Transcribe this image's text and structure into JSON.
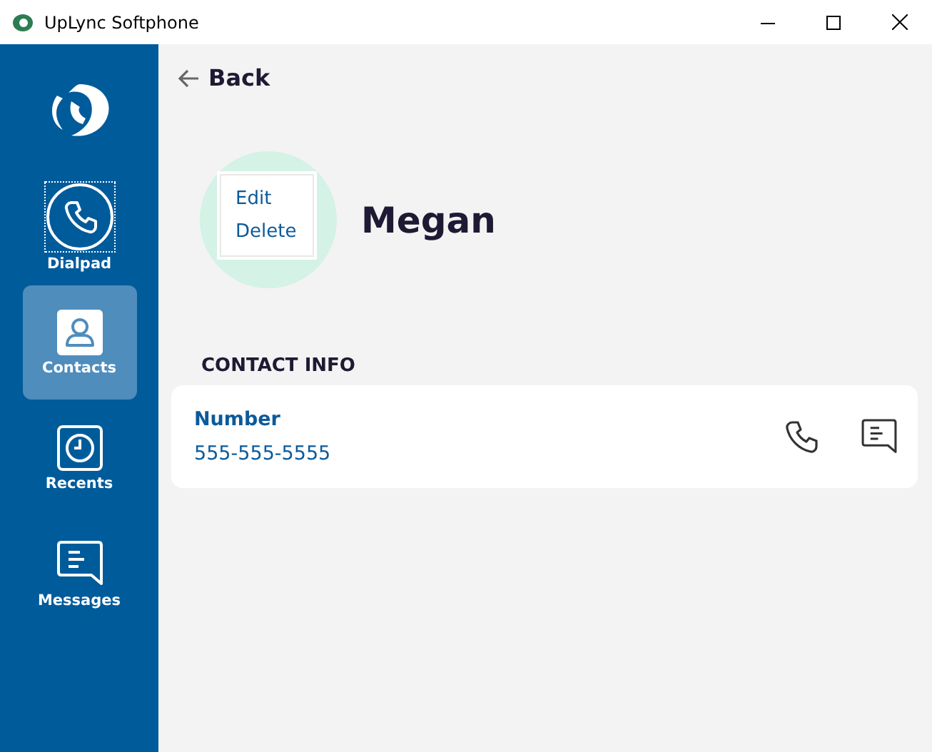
{
  "window": {
    "title": "UpLync Softphone"
  },
  "nav": [
    {
      "kind": "dialpad",
      "label": "Dialpad",
      "selected": false,
      "focused": true
    },
    {
      "kind": "contacts",
      "label": "Contacts",
      "selected": true,
      "focused": false
    },
    {
      "kind": "recents",
      "label": "Recents",
      "selected": false,
      "focused": false
    },
    {
      "kind": "messages",
      "label": "Messages",
      "selected": false,
      "focused": false
    }
  ],
  "back": "Back",
  "contact": {
    "name": "Megan"
  },
  "context_menu": [
    "Edit",
    "Delete"
  ],
  "section_title": "CONTACT INFO",
  "fields": [
    {
      "label": "Number",
      "value": "555-555-5555"
    }
  ]
}
